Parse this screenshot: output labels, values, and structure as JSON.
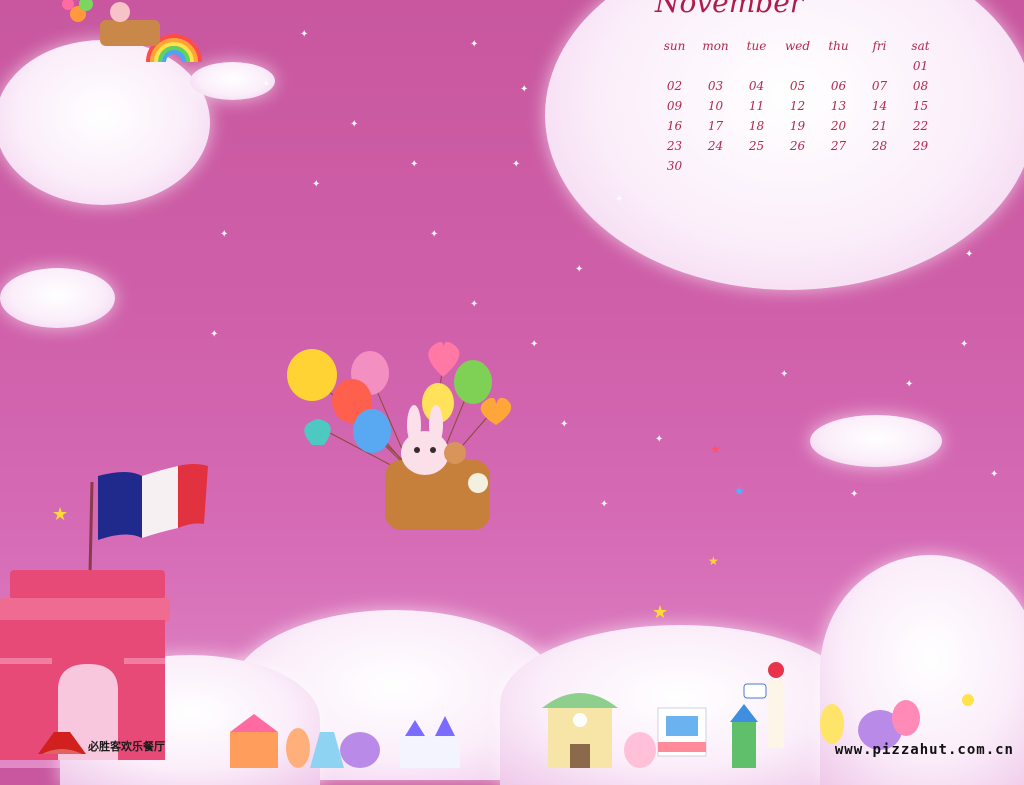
{
  "calendar": {
    "month": "November",
    "weekdays": [
      "sun",
      "mon",
      "tue",
      "wed",
      "thu",
      "fri",
      "sat"
    ],
    "weeks": [
      [
        "",
        "",
        "",
        "",
        "",
        "",
        "01"
      ],
      [
        "02",
        "03",
        "04",
        "05",
        "06",
        "07",
        "08"
      ],
      [
        "09",
        "10",
        "11",
        "12",
        "13",
        "14",
        "15"
      ],
      [
        "16",
        "17",
        "18",
        "19",
        "20",
        "21",
        "22"
      ],
      [
        "23",
        "24",
        "25",
        "26",
        "27",
        "28",
        "29"
      ],
      [
        "30",
        "",
        "",
        "",
        "",
        "",
        ""
      ]
    ]
  },
  "footer": {
    "brand": "必胜客欢乐餐厅",
    "url": "www.pizzahut.com.cn"
  },
  "colors": {
    "sky": "#cf5fa9",
    "calendar_text": "#b02a4c",
    "flag_blue": "#1f2a8c",
    "flag_red": "#e3323f",
    "arch_pink": "#e84a78"
  }
}
